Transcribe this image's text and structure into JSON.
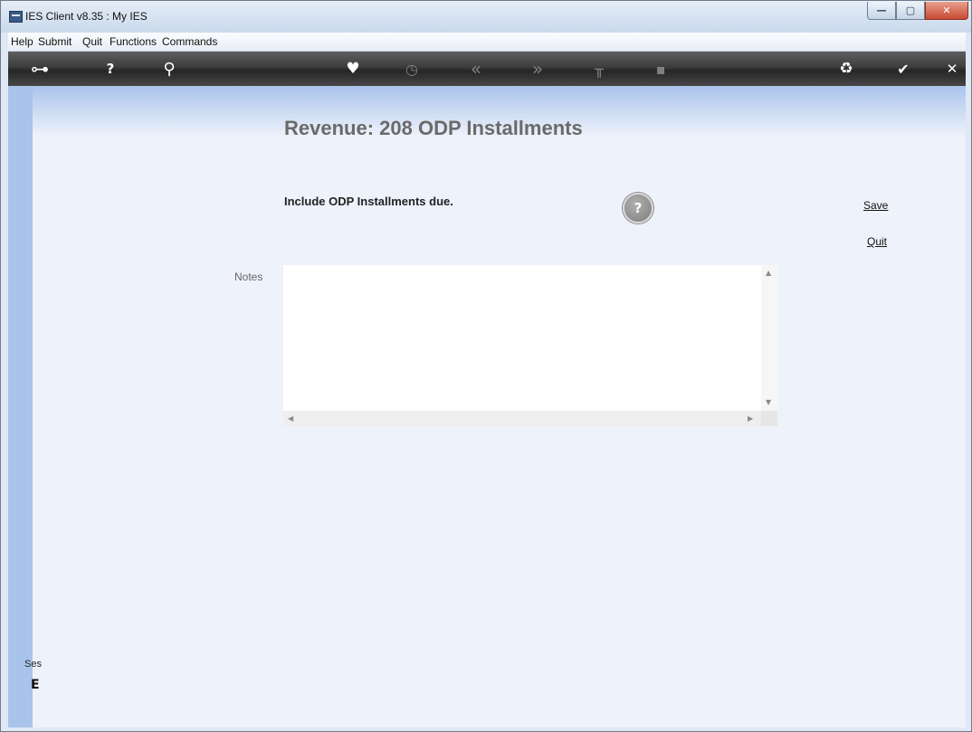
{
  "window": {
    "title": "IES Client v8.35 : My IES",
    "minimize": "—",
    "maximize": "▢",
    "close": "✕"
  },
  "menu": [
    "Help",
    "Submit",
    "Quit",
    "Functions",
    "Commands"
  ],
  "toolbar": {
    "icons": [
      "key-icon",
      "help-icon",
      "search-icon",
      "heart-icon",
      "clock-icon",
      "previous-icon",
      "next-icon",
      "tools-icon",
      "document-icon",
      "recycle-icon",
      "checkmark-icon",
      "close-icon"
    ],
    "glyphs": {
      "key": "⊶",
      "help": "?",
      "search": "⚲",
      "heart": "♥",
      "clock": "◷",
      "prev": "«",
      "next": "»",
      "tools": "╥",
      "doc": "▪",
      "recycle": "♻",
      "check": "✔",
      "close": "✕"
    }
  },
  "page": {
    "title": "Revenue: 208 ODP Installments",
    "prompt": "Include ODP Installments due.",
    "help_button": "?",
    "save_link": "Save",
    "quit_link": "Quit",
    "notes_label": "Notes",
    "notes_value": ""
  },
  "status": {
    "text": "Ses",
    "glyph": "E"
  },
  "colors": {
    "toolbar": "#3a3a3a",
    "content_bg": "#eef2fa",
    "left_strip": "#a9c3ea",
    "title_color": "#6a6a6a"
  }
}
